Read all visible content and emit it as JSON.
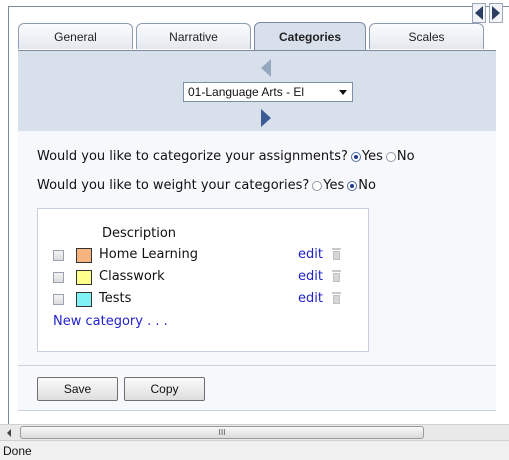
{
  "tabs": [
    {
      "label": "General",
      "active": false
    },
    {
      "label": "Narrative",
      "active": false
    },
    {
      "label": "Categories",
      "active": true
    },
    {
      "label": "Scales",
      "active": false
    }
  ],
  "class_selector": {
    "value": "01-Language Arts - El"
  },
  "questions": {
    "categorize": {
      "text": "Would you like to categorize your assignments?",
      "yes_label": "Yes",
      "no_label": "No",
      "selected": "Yes"
    },
    "weight": {
      "text": "Would you like to weight your categories?",
      "yes_label": "Yes",
      "no_label": "No",
      "selected": "No"
    }
  },
  "categories": {
    "header": "Description",
    "items": [
      {
        "name": "Home Learning",
        "color": "#f7b47f",
        "edit_label": "edit"
      },
      {
        "name": "Classwork",
        "color": "#ffff8c",
        "edit_label": "edit"
      },
      {
        "name": "Tests",
        "color": "#7ff2f5",
        "edit_label": "edit"
      }
    ],
    "new_label": "New category . . ."
  },
  "buttons": {
    "save": "Save",
    "copy": "Copy"
  },
  "scrollbar": {
    "thumb_grip": "III"
  },
  "status": {
    "text": "Done"
  },
  "colors": {
    "tab_active": "#d7e0eb",
    "link": "#2222cc",
    "band": "#d7e0eb"
  }
}
